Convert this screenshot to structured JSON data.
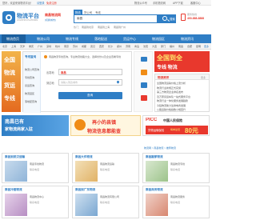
{
  "topbar": {
    "welcome": "您好，欢迎来到物流平台！",
    "login": "请登录",
    "register": "免费注册",
    "links": [
      "物流公众号",
      "手机物流网",
      "APP下载",
      "客服中心"
    ]
  },
  "logo": {
    "name": "物流平台",
    "sub": "LOGISTICS PLATFORM"
  },
  "location": {
    "city": "南昌物流网",
    "switch": "[切换城市]"
  },
  "search": {
    "tabs": [
      "物流",
      "货公司",
      "专线"
    ],
    "placeholder": "南昌",
    "hot_label": "热门：",
    "hot_links": [
      "南昌到北京",
      "南昌到上海",
      "南昌到广州"
    ],
    "button": "搜索"
  },
  "phone": {
    "label": "服务热线",
    "number": "400-888-8888"
  },
  "nav": {
    "items": [
      "物流首页",
      "物流公司",
      "物流专线",
      "落地配送",
      "货运中心",
      "物流园区",
      "物流资讯"
    ]
  },
  "city_bar": {
    "items": [
      "北京",
      "上海",
      "天津",
      "重庆",
      "广州",
      "深圳",
      "杭州",
      "南京",
      "苏州",
      "成都",
      "武汉",
      "西安",
      "长沙",
      "郑州",
      "济南",
      "青岛",
      "沈阳",
      "大连",
      "厦门",
      "福州",
      "南昌",
      "合肥",
      "昆明",
      "更多"
    ]
  },
  "query": {
    "title": "专线查询",
    "notice": "南昌物流专线查询，专业物流线路大全，选择省份以及企业查看专线",
    "from_label": "出发地",
    "from_value": "南昌",
    "to_label": "到达地",
    "to_placeholder": "请输入到达城市",
    "button": "查询",
    "side_items": [
      "物流公司查询",
      "专线查询",
      "货运查询",
      "物流园区",
      "落地配查询"
    ]
  },
  "left_banner": {
    "lines": [
      "全国",
      "物流",
      "货运",
      "专线"
    ]
  },
  "right_banner": {
    "title": "全国到全",
    "subtitle": "专线  物流"
  },
  "news": {
    "title": "物流资讯",
    "more": "更多",
    "items": [
      "全国物流运输价格上涨分析",
      "物流行业新规正式实施",
      "第三方物流企业排名发布",
      "近万家货运车队一站式服务平台",
      "物流行业一体化服务发展趋势",
      "冷链物流助力生鲜电商发展",
      "公路运输价格指数小幅回升"
    ]
  },
  "promo": {
    "left_line1": "南昌已有",
    "left_line2": "家物流商家入驻",
    "mid_line1": "再小的县镇",
    "mid_line2": "物流信息都能查",
    "picc_brand": "PICC",
    "picc_name": "中国人民保险",
    "picc_sub": "货物运输保险",
    "picc_price": "80元",
    "picc_note": "每单最低"
  },
  "breadcrumb": "物流网 > 南昌物流 > 推荐物流",
  "listings": [
    {
      "name": "南昌到武汉运输",
      "desc": "南昌专线物流",
      "tel": "联系电话"
    },
    {
      "name": "南昌大件物流",
      "desc": "南昌物流运输",
      "tel": "联系电话"
    },
    {
      "name": "南昌搬家物流",
      "desc": "南昌物流专线",
      "tel": "联系电话"
    },
    {
      "name": "南昌冷链物流",
      "desc": "南昌物流中心",
      "tel": "联系电话"
    },
    {
      "name": "南昌到广东物流",
      "desc": "南昌物流有限公司",
      "tel": "联系电话"
    },
    {
      "name": "南昌商务物流",
      "desc": "南昌物流服务",
      "tel": "联系电话"
    }
  ],
  "colors": {
    "brand": "#2f7ec5",
    "accent": "#e8382d",
    "orange": "#f08c16"
  }
}
